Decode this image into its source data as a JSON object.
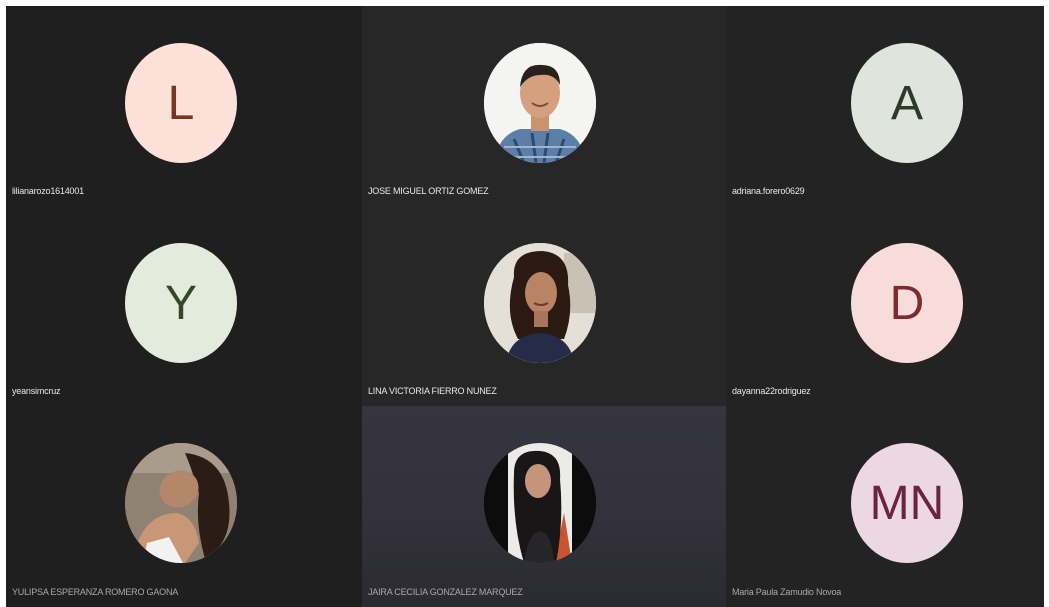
{
  "participants": [
    {
      "name": "lilianarozo1614001",
      "initial": "L",
      "avatar_bg": "#fde0d8",
      "avatar_fg": "#7a3422",
      "type": "initial"
    },
    {
      "name": "JOSE MIGUEL ORTIZ GOMEZ",
      "type": "photo",
      "photo": "man-plaid-shirt"
    },
    {
      "name": "adriana.forero0629",
      "initial": "A",
      "avatar_bg": "#dfe5dc",
      "avatar_fg": "#2d3a29",
      "type": "initial"
    },
    {
      "name": "yeansimcruz",
      "initial": "Y",
      "avatar_bg": "#e3ecdc",
      "avatar_fg": "#34472c",
      "type": "initial"
    },
    {
      "name": "LINA VICTORIA FIERRO NUNEZ",
      "type": "photo",
      "photo": "woman-curly-hair"
    },
    {
      "name": "dayanna22rodriguez",
      "initial": "D",
      "avatar_bg": "#f8dcdb",
      "avatar_fg": "#7c2c31",
      "type": "initial"
    },
    {
      "name": "YULIPSA ESPERANZA ROMERO GAONA",
      "type": "photo",
      "photo": "woman-lying"
    },
    {
      "name": "JAIRA CECILIA  GONZALEZ MARQUEZ",
      "type": "photo",
      "photo": "woman-dark-hair"
    },
    {
      "name": "Maria Paula Zamudio Novoa",
      "initial": "MN",
      "avatar_bg": "#ecd8e2",
      "avatar_fg": "#6b2440",
      "type": "initial"
    }
  ]
}
